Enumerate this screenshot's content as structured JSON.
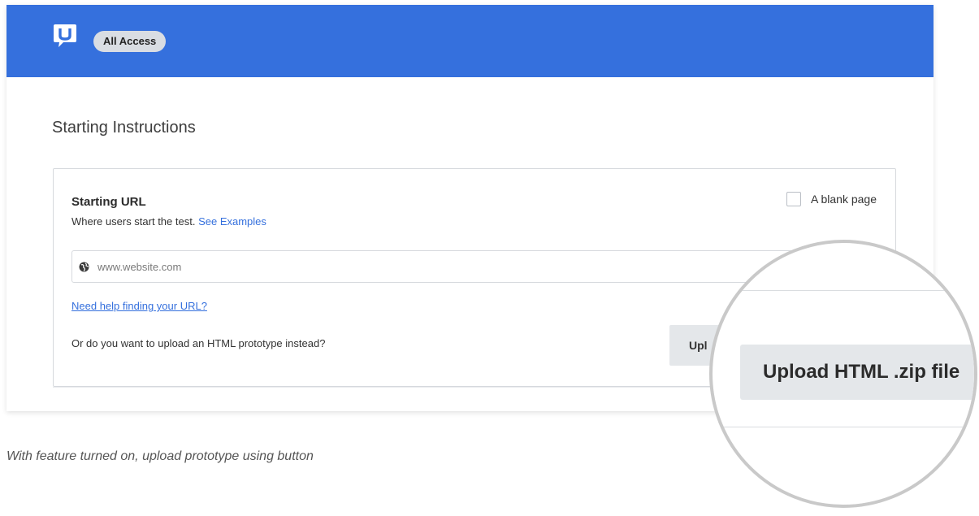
{
  "header": {
    "logo_letter": "U",
    "badge": "All Access",
    "brand_color": "#3570dd"
  },
  "main": {
    "title": "Starting Instructions",
    "starting_url": {
      "heading": "Starting URL",
      "subtitle": "Where users start the test.",
      "examples_link": "See Examples",
      "blank_page_label": "A blank page",
      "blank_page_checked": false,
      "url_placeholder": "www.website.com",
      "url_value": "",
      "help_link": "Need help finding your URL?",
      "prototype_question": "Or do you want to upload an HTML prototype instead?",
      "upload_button_partial": "Upl"
    }
  },
  "magnifier": {
    "upload_button": "Upload HTML .zip file"
  },
  "caption": "With feature turned on, upload prototype using button",
  "icons": {
    "logo": "usertesting-logo-icon",
    "globe": "globe-icon",
    "checkbox": "checkbox-icon"
  }
}
